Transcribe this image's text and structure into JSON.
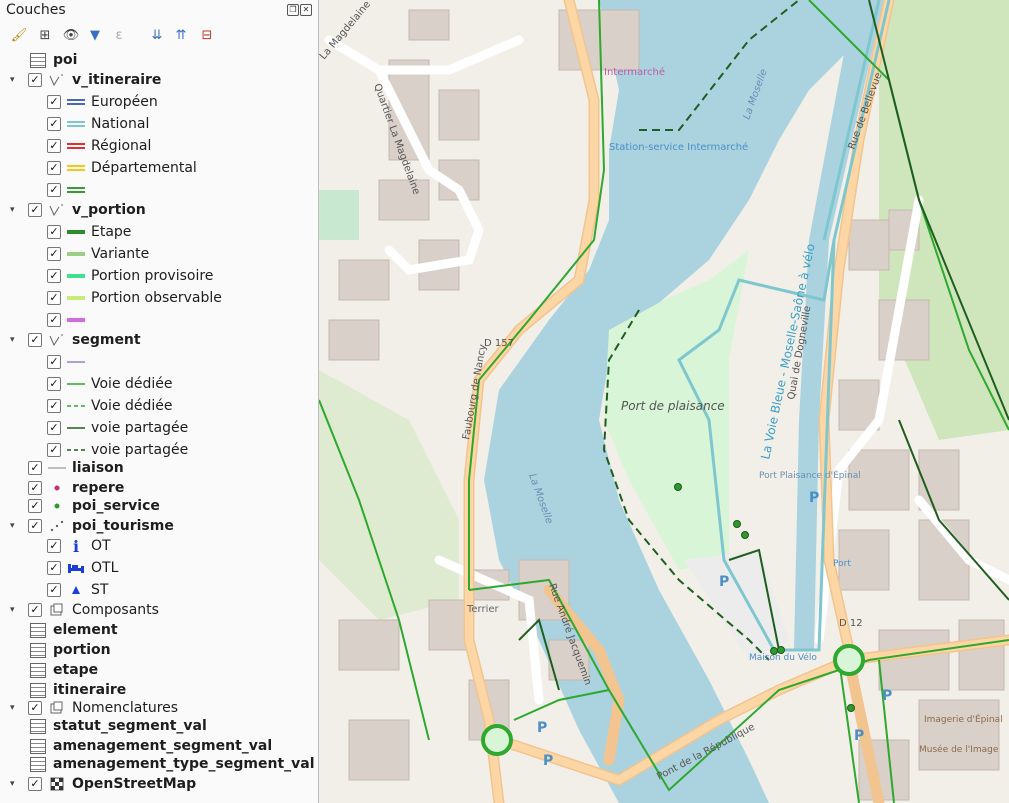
{
  "panel": {
    "title": "Couches",
    "toolbar": [
      "brush-icon",
      "add-group-icon",
      "eye-icon",
      "filter-icon",
      "expression-filter-icon",
      "expand-all-icon",
      "collapse-all-icon",
      "remove-layer-icon"
    ]
  },
  "tree": [
    {
      "label": "poi",
      "bold": true,
      "indent": 1,
      "checkbox": false,
      "symbol": "table"
    },
    {
      "label": "v_itineraire",
      "bold": true,
      "indent": 0,
      "checkbox": true,
      "expand": true,
      "symbol": "line-layer"
    },
    {
      "label": "Européen",
      "indent": 1,
      "checkbox": true,
      "symbol": "double-line",
      "color": "#4a69b5"
    },
    {
      "label": "National",
      "indent": 1,
      "checkbox": true,
      "symbol": "double-line",
      "color": "#7fc7cf"
    },
    {
      "label": "Régional",
      "indent": 1,
      "checkbox": true,
      "symbol": "double-line",
      "color": "#e03131"
    },
    {
      "label": "Départemental",
      "indent": 1,
      "checkbox": true,
      "symbol": "double-line",
      "color": "#f5c518"
    },
    {
      "label": "",
      "indent": 1,
      "checkbox": true,
      "symbol": "double-line",
      "color": "#3a9a3a"
    },
    {
      "label": "v_portion",
      "bold": true,
      "indent": 0,
      "checkbox": true,
      "expand": true,
      "symbol": "line-layer"
    },
    {
      "label": "Etape",
      "indent": 1,
      "checkbox": true,
      "symbol": "thick-line",
      "color": "#2e8b2e"
    },
    {
      "label": "Variante",
      "indent": 1,
      "checkbox": true,
      "symbol": "thick-line",
      "color": "#9ccf84"
    },
    {
      "label": "Portion provisoire",
      "indent": 1,
      "checkbox": true,
      "symbol": "thick-line",
      "color": "#3ee08e"
    },
    {
      "label": "Portion observable",
      "indent": 1,
      "checkbox": true,
      "symbol": "thick-line",
      "color": "#c8ec7a"
    },
    {
      "label": "",
      "indent": 1,
      "checkbox": true,
      "symbol": "thick-line",
      "color": "#d36be0"
    },
    {
      "label": "segment",
      "bold": true,
      "indent": 0,
      "checkbox": true,
      "expand": true,
      "symbol": "line-layer"
    },
    {
      "label": "",
      "indent": 1,
      "checkbox": true,
      "symbol": "thin-line",
      "color": "#9b7fcf"
    },
    {
      "label": "Voie dédiée",
      "indent": 1,
      "checkbox": true,
      "symbol": "thin-line",
      "color": "#2ea82e"
    },
    {
      "label": "Voie dédiée",
      "indent": 1,
      "checkbox": true,
      "symbol": "dash-line",
      "color": "#2ea82e"
    },
    {
      "label": "voie partagée",
      "indent": 1,
      "checkbox": true,
      "symbol": "thin-line",
      "color": "#1e5e1e"
    },
    {
      "label": "voie partagée",
      "indent": 1,
      "checkbox": true,
      "symbol": "dash-line",
      "color": "#1e5e1e"
    },
    {
      "label": "liaison",
      "bold": true,
      "indent": 0,
      "checkbox": true,
      "symbol": "thin-line",
      "color": "#aaaaaa"
    },
    {
      "label": "repere",
      "bold": true,
      "indent": 0,
      "checkbox": true,
      "symbol": "dot",
      "color": "#c03070"
    },
    {
      "label": "poi_service",
      "bold": true,
      "indent": 0,
      "checkbox": true,
      "symbol": "dot",
      "color": "#2e9a2e"
    },
    {
      "label": "poi_tourisme",
      "bold": true,
      "indent": 0,
      "checkbox": true,
      "expand": true,
      "symbol": "point-layer"
    },
    {
      "label": "OT",
      "indent": 1,
      "checkbox": true,
      "symbol": "info",
      "color": "#1b3fd6"
    },
    {
      "label": "OTL",
      "indent": 1,
      "checkbox": true,
      "symbol": "bed",
      "color": "#1b3fd6"
    },
    {
      "label": "ST",
      "indent": 1,
      "checkbox": true,
      "symbol": "triangle",
      "color": "#1b3fd6"
    },
    {
      "label": "Composants",
      "indent": 0,
      "checkbox": true,
      "expand": true,
      "symbol": "group"
    },
    {
      "label": "element",
      "bold": true,
      "indent": 1,
      "checkbox": false,
      "symbol": "table"
    },
    {
      "label": "portion",
      "bold": true,
      "indent": 1,
      "checkbox": false,
      "symbol": "table"
    },
    {
      "label": "etape",
      "bold": true,
      "indent": 1,
      "checkbox": false,
      "symbol": "table"
    },
    {
      "label": "itineraire",
      "bold": true,
      "indent": 1,
      "checkbox": false,
      "symbol": "table"
    },
    {
      "label": "Nomenclatures",
      "indent": 0,
      "checkbox": true,
      "expand": true,
      "symbol": "group"
    },
    {
      "label": "statut_segment_val",
      "bold": true,
      "indent": 1,
      "checkbox": false,
      "symbol": "table"
    },
    {
      "label": "amenagement_segment_val",
      "bold": true,
      "indent": 1,
      "checkbox": false,
      "symbol": "table"
    },
    {
      "label": "amenagement_type_segment_val",
      "bold": true,
      "indent": 1,
      "checkbox": false,
      "symbol": "table"
    },
    {
      "label": "OpenStreetMap",
      "bold": true,
      "indent": 0,
      "checkbox": true,
      "expand": true,
      "symbol": "raster"
    }
  ],
  "map": {
    "labels": {
      "intermarche": "Intermarché",
      "station": "Station-service Intermarché",
      "port": "Port de plaisance",
      "la_moselle_1": "La Moselle",
      "la_moselle_2": "La Moselle",
      "voie_bleue": "La Voie Bleue - Moselle-Saône à vélo",
      "quai": "Quai de Dogneville",
      "rue_bellevue": "Rue de Bellevue",
      "faubourg": "Faubourg de Nancy",
      "rue_andre": "Rue André Jacquemin",
      "pont": "Pont de la République",
      "la_magdelaine": "La Magdelaine",
      "quartier": "Quartier La Magdelaine",
      "d157": "D 157",
      "d12": "D 12",
      "terrier": "Terrier",
      "port_epinal": "Port Plaisance d'Épinal",
      "port_small": "Port",
      "maison_velo": "Maison du Vélo",
      "imagerie": "Imagerie d'Épinal",
      "musee": "Musée de l'Image"
    }
  }
}
